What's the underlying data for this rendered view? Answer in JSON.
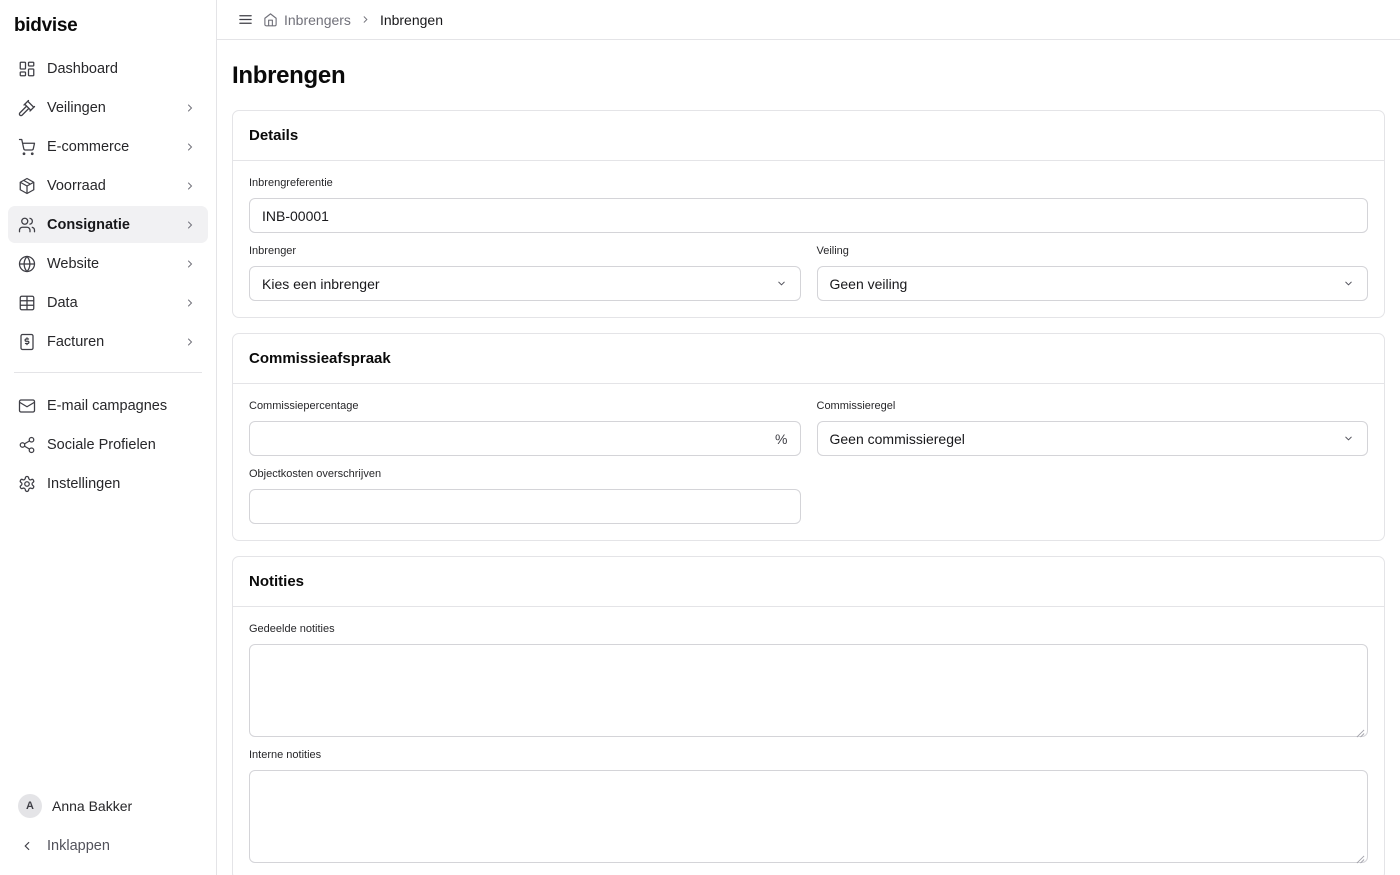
{
  "app": {
    "logo": "bidvise"
  },
  "sidebar": {
    "items": [
      {
        "label": "Dashboard",
        "icon": "dashboard-icon",
        "chevron": false,
        "active": false
      },
      {
        "label": "Veilingen",
        "icon": "gavel-icon",
        "chevron": true,
        "active": false
      },
      {
        "label": "E-commerce",
        "icon": "cart-icon",
        "chevron": true,
        "active": false
      },
      {
        "label": "Voorraad",
        "icon": "package-icon",
        "chevron": true,
        "active": false
      },
      {
        "label": "Consignatie",
        "icon": "users-icon",
        "chevron": true,
        "active": true
      },
      {
        "label": "Website",
        "icon": "globe-icon",
        "chevron": true,
        "active": false
      },
      {
        "label": "Data",
        "icon": "table-icon",
        "chevron": true,
        "active": false
      },
      {
        "label": "Facturen",
        "icon": "invoice-icon",
        "chevron": true,
        "active": false
      }
    ],
    "secondary": [
      {
        "label": "E-mail campagnes",
        "icon": "mail-icon"
      },
      {
        "label": "Sociale Profielen",
        "icon": "share-icon"
      },
      {
        "label": "Instellingen",
        "icon": "gear-icon"
      }
    ],
    "user": {
      "initial": "A",
      "name": "Anna Bakker"
    },
    "collapse_label": "Inklappen"
  },
  "breadcrumb": {
    "parent": "Inbrengers",
    "current": "Inbrengen"
  },
  "page": {
    "title": "Inbrengen"
  },
  "details": {
    "title": "Details",
    "reference_label": "Inbrengreferentie",
    "reference_value": "INB-00001",
    "consignor_label": "Inbrenger",
    "consignor_value": "Kies een inbrenger",
    "auction_label": "Veiling",
    "auction_value": "Geen veiling"
  },
  "commission": {
    "title": "Commissieafspraak",
    "percentage_label": "Commissiepercentage",
    "percentage_value": "",
    "percentage_suffix": "%",
    "rule_label": "Commissieregel",
    "rule_value": "Geen commissieregel",
    "costs_label": "Objectkosten overschrijven",
    "costs_value": ""
  },
  "notes": {
    "title": "Notities",
    "shared_label": "Gedeelde notities",
    "internal_label": "Interne notities"
  }
}
